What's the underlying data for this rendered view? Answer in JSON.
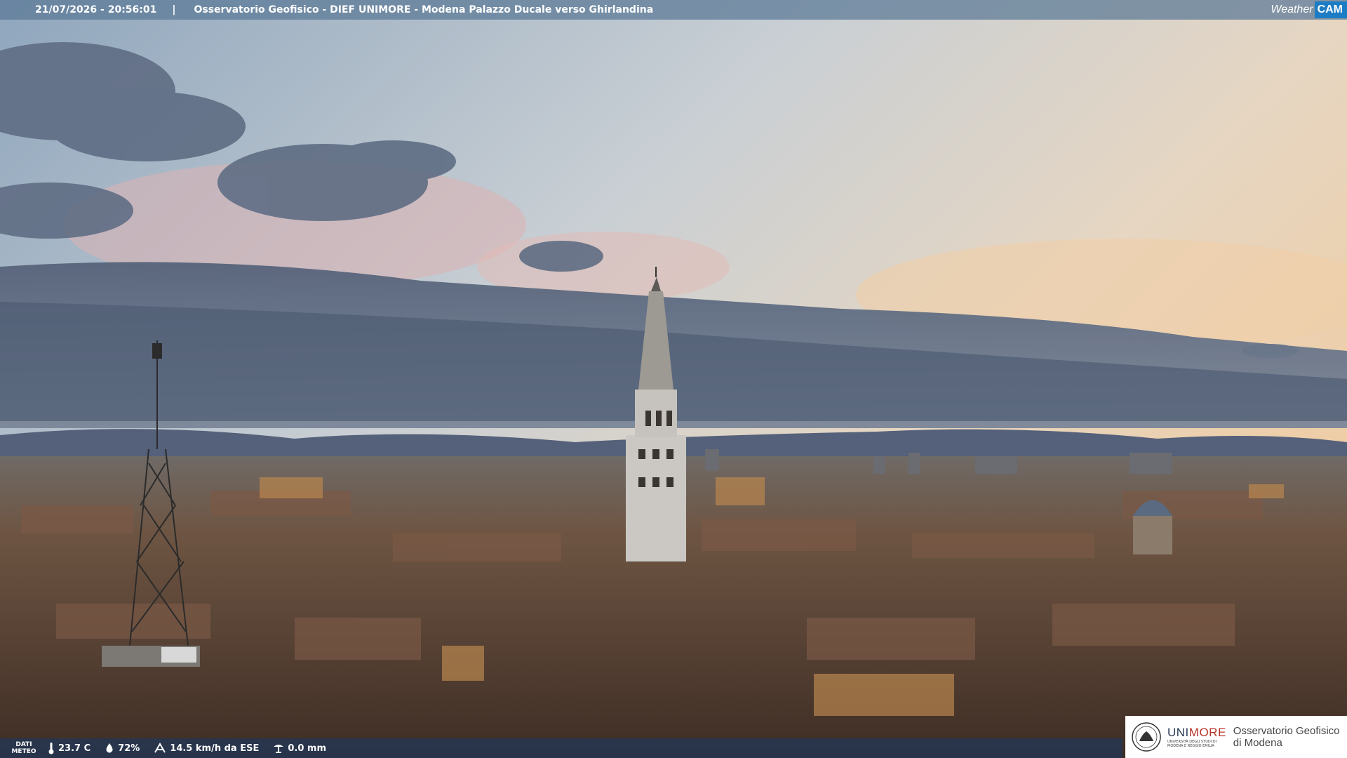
{
  "header": {
    "datetime": "21/07/2026 - 20:56:01",
    "separator": "|",
    "title": "Osservatorio Geofisico - DIEF UNIMORE - Modena Palazzo Ducale verso Ghirlandina",
    "logo_weather": "Weather",
    "logo_cam": "CAM"
  },
  "weather": {
    "label_line1": "DATI",
    "label_line2": "METEO",
    "temperature": "23.7 C",
    "humidity": "72%",
    "wind": "14.5 km/h da ESE",
    "rain": "0.0 mm"
  },
  "branding": {
    "uni_prefix": "UNI",
    "uni_suffix": "MORE",
    "uni_subtitle_1": "UNIVERSITÀ DEGLI STUDI DI",
    "uni_subtitle_2": "MODENA E REGGIO EMILIA",
    "observatory_line1": "Osservatorio Geofisico",
    "observatory_line2": "di Modena"
  },
  "colors": {
    "sky_top": "#7f97b0",
    "sky_warm": "#e9c9a7",
    "cloud": "#5d6b80",
    "city": "#5a4435",
    "cam_accent": "#1c7cc4",
    "unimore_red": "#b7342c"
  }
}
